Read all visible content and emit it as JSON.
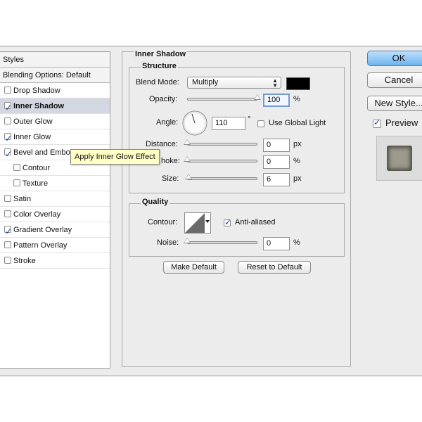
{
  "left_list": {
    "header": "Styles",
    "blending": "Blending Options: Default",
    "items": [
      {
        "label": "Drop Shadow",
        "checked": false
      },
      {
        "label": "Inner Shadow",
        "checked": true
      },
      {
        "label": "Outer Glow",
        "checked": false
      },
      {
        "label": "Inner Glow",
        "checked": true
      },
      {
        "label": "Bevel and Emboss",
        "checked": true
      },
      {
        "label": "Contour",
        "checked": false
      },
      {
        "label": "Texture",
        "checked": false
      },
      {
        "label": "Satin",
        "checked": false
      },
      {
        "label": "Color Overlay",
        "checked": false
      },
      {
        "label": "Gradient Overlay",
        "checked": true
      },
      {
        "label": "Pattern Overlay",
        "checked": false
      },
      {
        "label": "Stroke",
        "checked": false
      }
    ],
    "bevel_visible_label": "Bevel and Embo"
  },
  "tooltip": "Apply Inner Glow Effect",
  "panel": {
    "title": "Inner Shadow",
    "structure": {
      "legend": "Structure",
      "blend_mode_label": "Blend Mode:",
      "blend_mode_value": "Multiply",
      "color_swatch": "#000000",
      "opacity_label": "Opacity:",
      "opacity_value": "100",
      "opacity_unit": "%",
      "opacity_level": 1.0,
      "angle_label": "Angle:",
      "angle_value": "110",
      "angle_unit": "°",
      "use_global_light": "Use Global Light",
      "use_global_light_checked": false,
      "distance_label": "Distance:",
      "distance_value": "0",
      "distance_unit": "px",
      "distance_level": 0,
      "choke_label": "Choke:",
      "choke_visible_label": "hoke:",
      "choke_value": "0",
      "choke_unit": "%",
      "choke_level": 0,
      "size_label": "Size:",
      "size_value": "6",
      "size_unit": "px",
      "size_level": 0.024
    },
    "quality": {
      "legend": "Quality",
      "contour_label": "Contour:",
      "anti_aliased": "Anti-aliased",
      "anti_aliased_checked": true,
      "noise_label": "Noise:",
      "noise_value": "0",
      "noise_unit": "%",
      "noise_level": 0
    },
    "make_default": "Make Default",
    "reset_default": "Reset to Default"
  },
  "right": {
    "ok": "OK",
    "cancel": "Cancel",
    "new_style": "New Style...",
    "preview": "Preview",
    "preview_checked": true
  },
  "icons": {
    "angle_dial": "angle-dial-icon",
    "contour": "contour-curve-icon",
    "select_arrows": "up-down-arrows-icon"
  }
}
